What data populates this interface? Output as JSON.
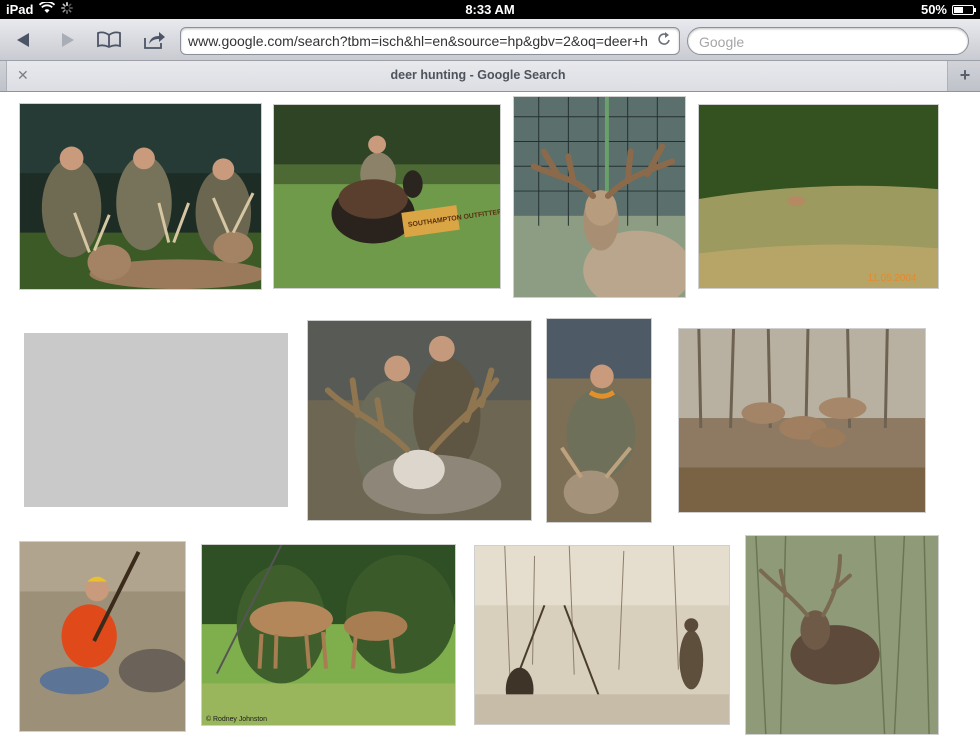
{
  "status_bar": {
    "device": "iPad",
    "time": "8:33 AM",
    "battery": "50%",
    "battery_level": 0.5
  },
  "toolbar": {
    "url": "www.google.com/search?tbm=isch&hl=en&source=hp&gbv=2&oq=deer+h",
    "search_placeholder": "Google"
  },
  "tabs": [
    {
      "title": "deer hunting - Google Search"
    }
  ],
  "results": {
    "image_count": 13,
    "watermark_1": "11.05.2004",
    "watermark_2": "© Rodney Johnston",
    "sign_text": "SOUTHAMPTON OUTFITTERS"
  }
}
